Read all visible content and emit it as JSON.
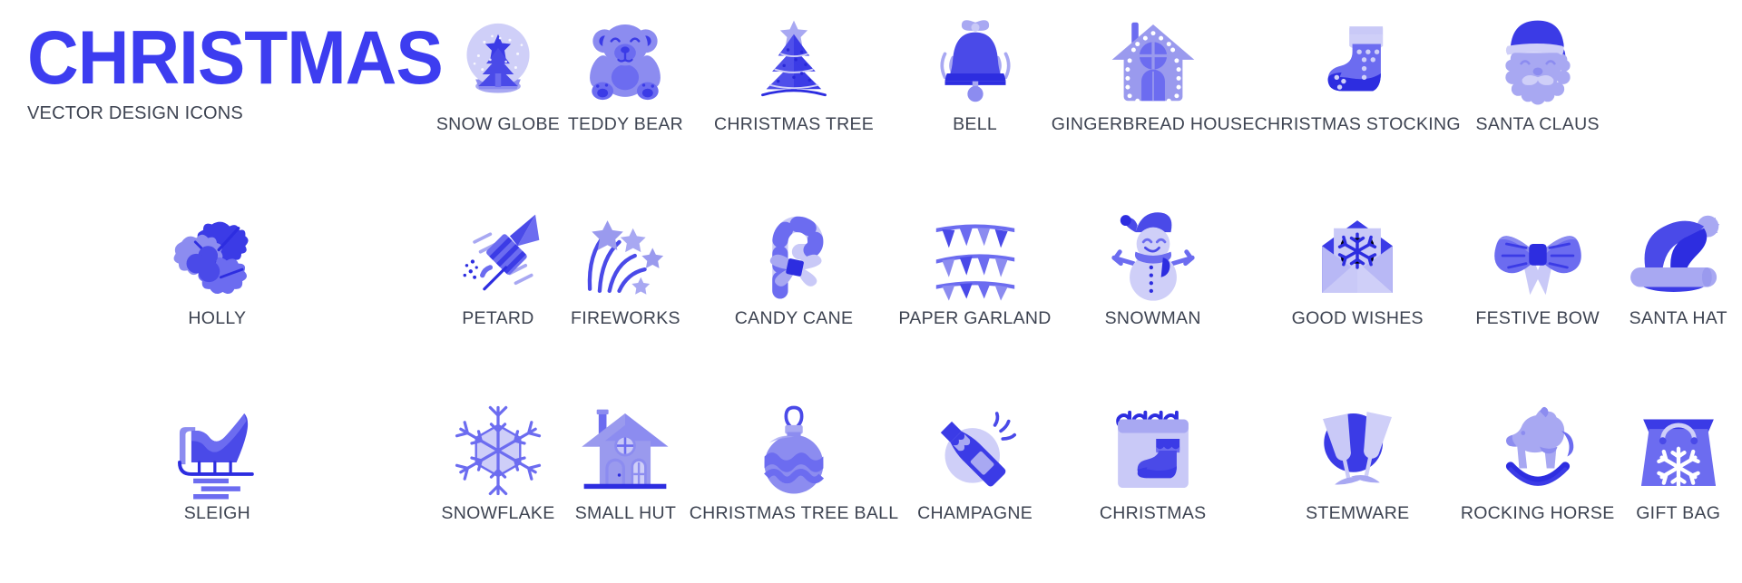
{
  "brand": {
    "title": "CHRISTMAS",
    "subtitle": "VECTOR DESIGN ICONS",
    "title_color": "#3d3df0",
    "label_color": "#3d4351"
  },
  "palette": {
    "deep_blue": "#2d2de0",
    "blue": "#4a4ae8",
    "mid_blue": "#6c6cf0",
    "periwinkle": "#8c8cf0",
    "light_periwinkle": "#a8a8f2",
    "pale": "#c9c9f7",
    "paler": "#dcdcfb",
    "white": "#ffffff",
    "background": "#ffffff"
  },
  "grid": {
    "columns": 9,
    "rows": 3,
    "total_icons": 27
  },
  "rows": [
    {
      "index": 1,
      "cells": [
        {
          "type": "title"
        },
        {
          "type": "icon",
          "id": "snow-globe",
          "label": "SNOW GLOBE"
        },
        {
          "type": "icon",
          "id": "teddy-bear",
          "label": "TEDDY BEAR"
        },
        {
          "type": "icon",
          "id": "christmas-tree",
          "label": "CHRISTMAS TREE"
        },
        {
          "type": "icon",
          "id": "bell",
          "label": "BELL"
        },
        {
          "type": "icon",
          "id": "gingerbread-house",
          "label": "GINGERBREAD HOUSE"
        },
        {
          "type": "icon",
          "id": "christmas-stocking",
          "label": "CHRISTMAS STOCKING"
        },
        {
          "type": "icon",
          "id": "santa-claus",
          "label": "SANTA CLAUS"
        },
        {
          "type": "spacer"
        }
      ]
    },
    {
      "index": 2,
      "cells": [
        {
          "type": "icon",
          "id": "holly",
          "label": "HOLLY"
        },
        {
          "type": "icon",
          "id": "petard",
          "label": "PETARD"
        },
        {
          "type": "icon",
          "id": "fireworks",
          "label": "FIREWORKS"
        },
        {
          "type": "icon",
          "id": "candy-cane",
          "label": "CANDY CANE"
        },
        {
          "type": "icon",
          "id": "paper-garland",
          "label": "PAPER GARLAND"
        },
        {
          "type": "icon",
          "id": "snowman",
          "label": "SNOWMAN"
        },
        {
          "type": "icon",
          "id": "good-wishes",
          "label": "GOOD WISHES"
        },
        {
          "type": "icon",
          "id": "festive-bow",
          "label": "FESTIVE BOW"
        },
        {
          "type": "icon",
          "id": "santa-hat",
          "label": "SANTA HAT"
        }
      ]
    },
    {
      "index": 3,
      "cells": [
        {
          "type": "icon",
          "id": "sleigh",
          "label": "SLEIGH"
        },
        {
          "type": "icon",
          "id": "snowflake",
          "label": "SNOWFLAKE"
        },
        {
          "type": "icon",
          "id": "small-hut",
          "label": "SMALL HUT"
        },
        {
          "type": "icon",
          "id": "christmas-tree-ball",
          "label": "CHRISTMAS TREE BALL"
        },
        {
          "type": "icon",
          "id": "champagne",
          "label": "CHAMPAGNE"
        },
        {
          "type": "icon",
          "id": "christmas",
          "label": "CHRISTMAS"
        },
        {
          "type": "icon",
          "id": "stemware",
          "label": "STEMWARE"
        },
        {
          "type": "icon",
          "id": "rocking-horse",
          "label": "ROCKING HORSE"
        },
        {
          "type": "icon",
          "id": "gift-bag",
          "label": "GIFT BAG"
        }
      ]
    }
  ]
}
